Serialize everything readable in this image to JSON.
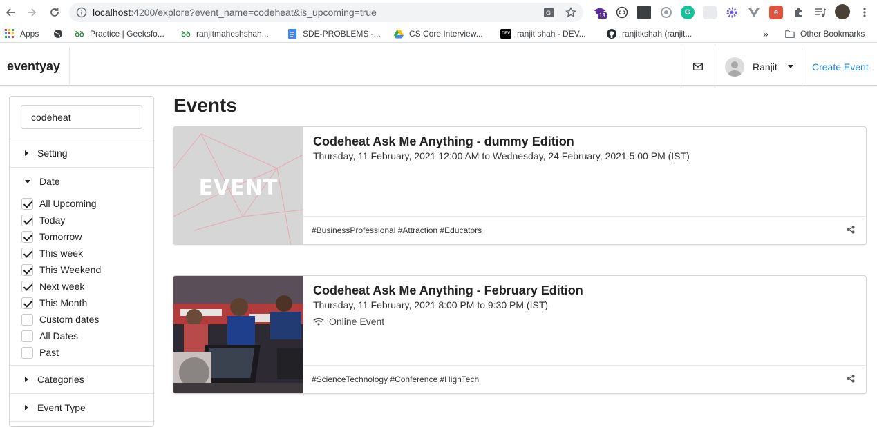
{
  "browser": {
    "url_host": "localhost",
    "url_path": ":4200/explore?event_name=codeheat&is_upcoming=true",
    "ext_badge": "13",
    "bookmarks": [
      {
        "label": "Apps",
        "icon": "apps-grid-icon"
      },
      {
        "label": "",
        "icon": "globe-icon"
      },
      {
        "label": "Practice | Geeksfo...",
        "icon": "geeksforgeeks-icon"
      },
      {
        "label": "ranjitmaheshshah...",
        "icon": "geeksforgeeks-icon"
      },
      {
        "label": "SDE-PROBLEMS -...",
        "icon": "google-docs-icon"
      },
      {
        "label": "CS Core Interview...",
        "icon": "google-drive-icon"
      },
      {
        "label": "ranjit shah - DEV...",
        "icon": "dev-icon"
      },
      {
        "label": "ranjitkshah (ranjit...",
        "icon": "github-icon"
      }
    ],
    "more_label": "»",
    "other_bookmarks": "Other Bookmarks"
  },
  "app": {
    "brand": "eventyay",
    "user_name": "Ranjit",
    "create_event": "Create Event"
  },
  "sidebar": {
    "search_value": "codeheat",
    "setting_label": "Setting",
    "date_label": "Date",
    "date_options": [
      {
        "label": "All Upcoming",
        "checked": true
      },
      {
        "label": "Today",
        "checked": true
      },
      {
        "label": "Tomorrow",
        "checked": true
      },
      {
        "label": "This week",
        "checked": true
      },
      {
        "label": "This Weekend",
        "checked": true
      },
      {
        "label": "Next week",
        "checked": true
      },
      {
        "label": "This Month",
        "checked": true
      },
      {
        "label": "Custom dates",
        "checked": false
      },
      {
        "label": "All Dates",
        "checked": false
      },
      {
        "label": "Past",
        "checked": false
      }
    ],
    "categories_label": "Categories",
    "event_type_label": "Event Type"
  },
  "main": {
    "title": "Events",
    "events": [
      {
        "title": "Codeheat Ask Me Anything - dummy Edition",
        "date": "Thursday, 11 February, 2021 12:00 AM to Wednesday, 24 February, 2021 5:00 PM (IST)",
        "online": "",
        "tags": "#BusinessProfessional #Attraction #Educators",
        "image_text": "EVENT"
      },
      {
        "title": "Codeheat Ask Me Anything - February Edition",
        "date": "Thursday, 11 February, 2021 8:00 PM to 9:30 PM (IST)",
        "online": "Online Event",
        "tags": "#ScienceTechnology #Conference #HighTech",
        "image_text": ""
      }
    ]
  },
  "colors": {
    "link": "#2185d0",
    "checkbox_check": "#222222",
    "border": "#d4d4d5"
  }
}
